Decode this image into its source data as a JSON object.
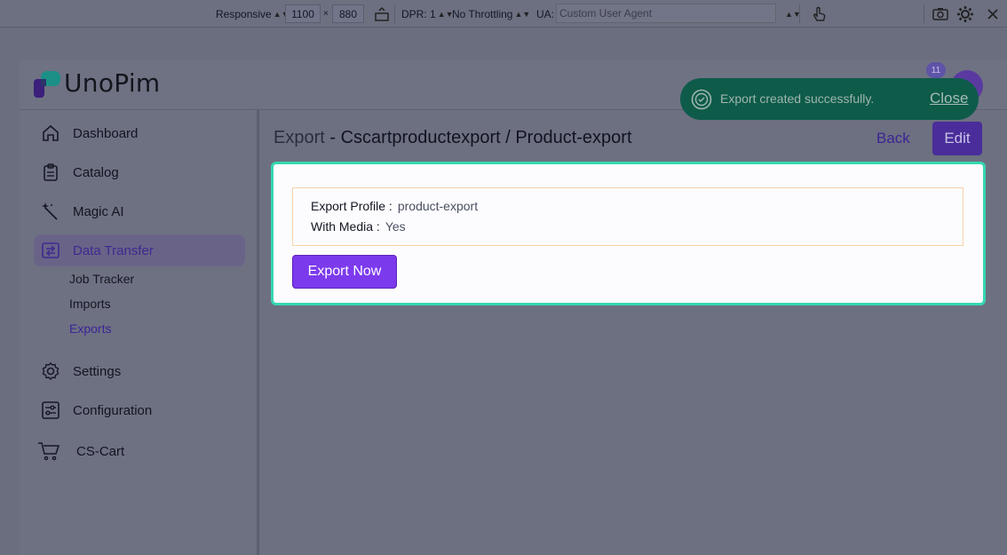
{
  "devtools": {
    "device": "Responsive",
    "width": "1100",
    "times": "×",
    "height": "880",
    "dpr": "DPR: 1",
    "throttling": "No Throttling",
    "ua_label": "UA:",
    "ua_placeholder": "Custom User Agent"
  },
  "brand": {
    "name": "UnoPim"
  },
  "sidebar": {
    "items": [
      {
        "label": "Dashboard",
        "icon": "home-icon"
      },
      {
        "label": "Catalog",
        "icon": "clipboard-icon"
      },
      {
        "label": "Magic AI",
        "icon": "magic-wand-icon"
      },
      {
        "label": "Data Transfer",
        "icon": "data-transfer-icon",
        "active": true
      },
      {
        "label": "Settings",
        "icon": "gear-icon"
      },
      {
        "label": "Configuration",
        "icon": "sliders-icon"
      },
      {
        "label": "CS-Cart",
        "icon": "cart-icon"
      }
    ],
    "sub_items": [
      {
        "label": "Job Tracker"
      },
      {
        "label": "Imports"
      },
      {
        "label": "Exports",
        "active": true
      }
    ]
  },
  "page": {
    "title_prefix": "Export",
    "title_sep": " - ",
    "title_main": "Cscartproductexport / Product-export",
    "back_label": "Back",
    "edit_label": "Edit"
  },
  "details": {
    "profile_label": "Export Profile :",
    "profile_value": "product-export",
    "media_label": "With Media :",
    "media_value": "Yes",
    "export_button": "Export Now"
  },
  "toast": {
    "message": "Export created successfully.",
    "close_label": "Close"
  },
  "header": {
    "notification_count": "11"
  },
  "colors": {
    "accent": "#7c3aed",
    "highlight_border": "#35d6b1",
    "toast_bg": "#0e5b4a"
  }
}
